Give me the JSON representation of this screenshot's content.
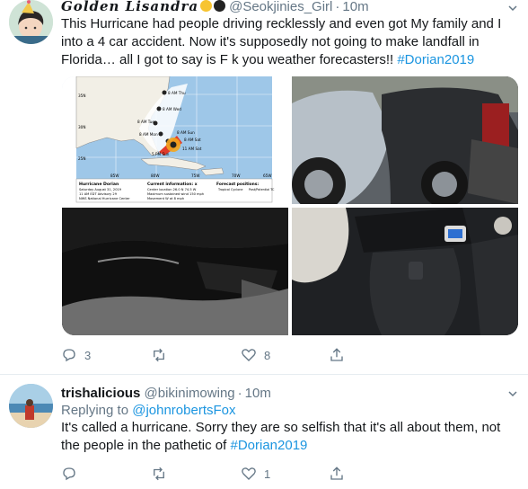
{
  "tweets": [
    {
      "name": "Golden Lisandra",
      "handle": "@Seokjinies_Girl",
      "time": "10m",
      "text_pre": "This Hurricane had people driving recklessly and even got My family and I into a 4 car accident. Now it's supposedly not going to make landfall in Florida… all I got to say is F",
      "text_censor": "  k",
      "text_post": " you weather forecasters!! ",
      "hashtag": "#Dorian2019",
      "map": {
        "title": "Hurricane Dorian",
        "date": "Saturday August 31, 2019",
        "advisory": "11 AM EDT Advisory 29",
        "center": "NWS National Hurricane Center",
        "info_title": "Current information: x",
        "info_1": "Center location 26.0 N 74.5 W",
        "info_2": "Maximum sustained wind 150 mph",
        "info_3": "Movement W at 8 mph",
        "forecast_title": "Forecast positions:",
        "forecast_1": "Tropical Cyclone",
        "forecast_2": "Post/Potential TC",
        "day_labels": [
          "8 AM Thu",
          "8 AM Wed",
          "8 AM Tue",
          "8 AM Mon",
          "8 AM Sun",
          "8 AM Sat",
          "5 PM Sun",
          "11 AM Sat"
        ],
        "lat_labels": [
          "35N",
          "30N",
          "25N"
        ],
        "lon_labels": [
          "85W",
          "80W",
          "75W",
          "70W",
          "65W"
        ]
      },
      "replies": "3",
      "retweets": "",
      "likes": "8"
    },
    {
      "name": "trishalicious",
      "handle": "@bikinimowing",
      "time": "10m",
      "replying_label": "Replying to ",
      "replying_handle": "@johnrobertsFox",
      "text_pre": "It's called a hurricane. Sorry they are so selfish that it's all about them, not the people in the pathetic of ",
      "hashtag": "#Dorian2019",
      "replies": "",
      "retweets": "",
      "likes": "1"
    }
  ]
}
